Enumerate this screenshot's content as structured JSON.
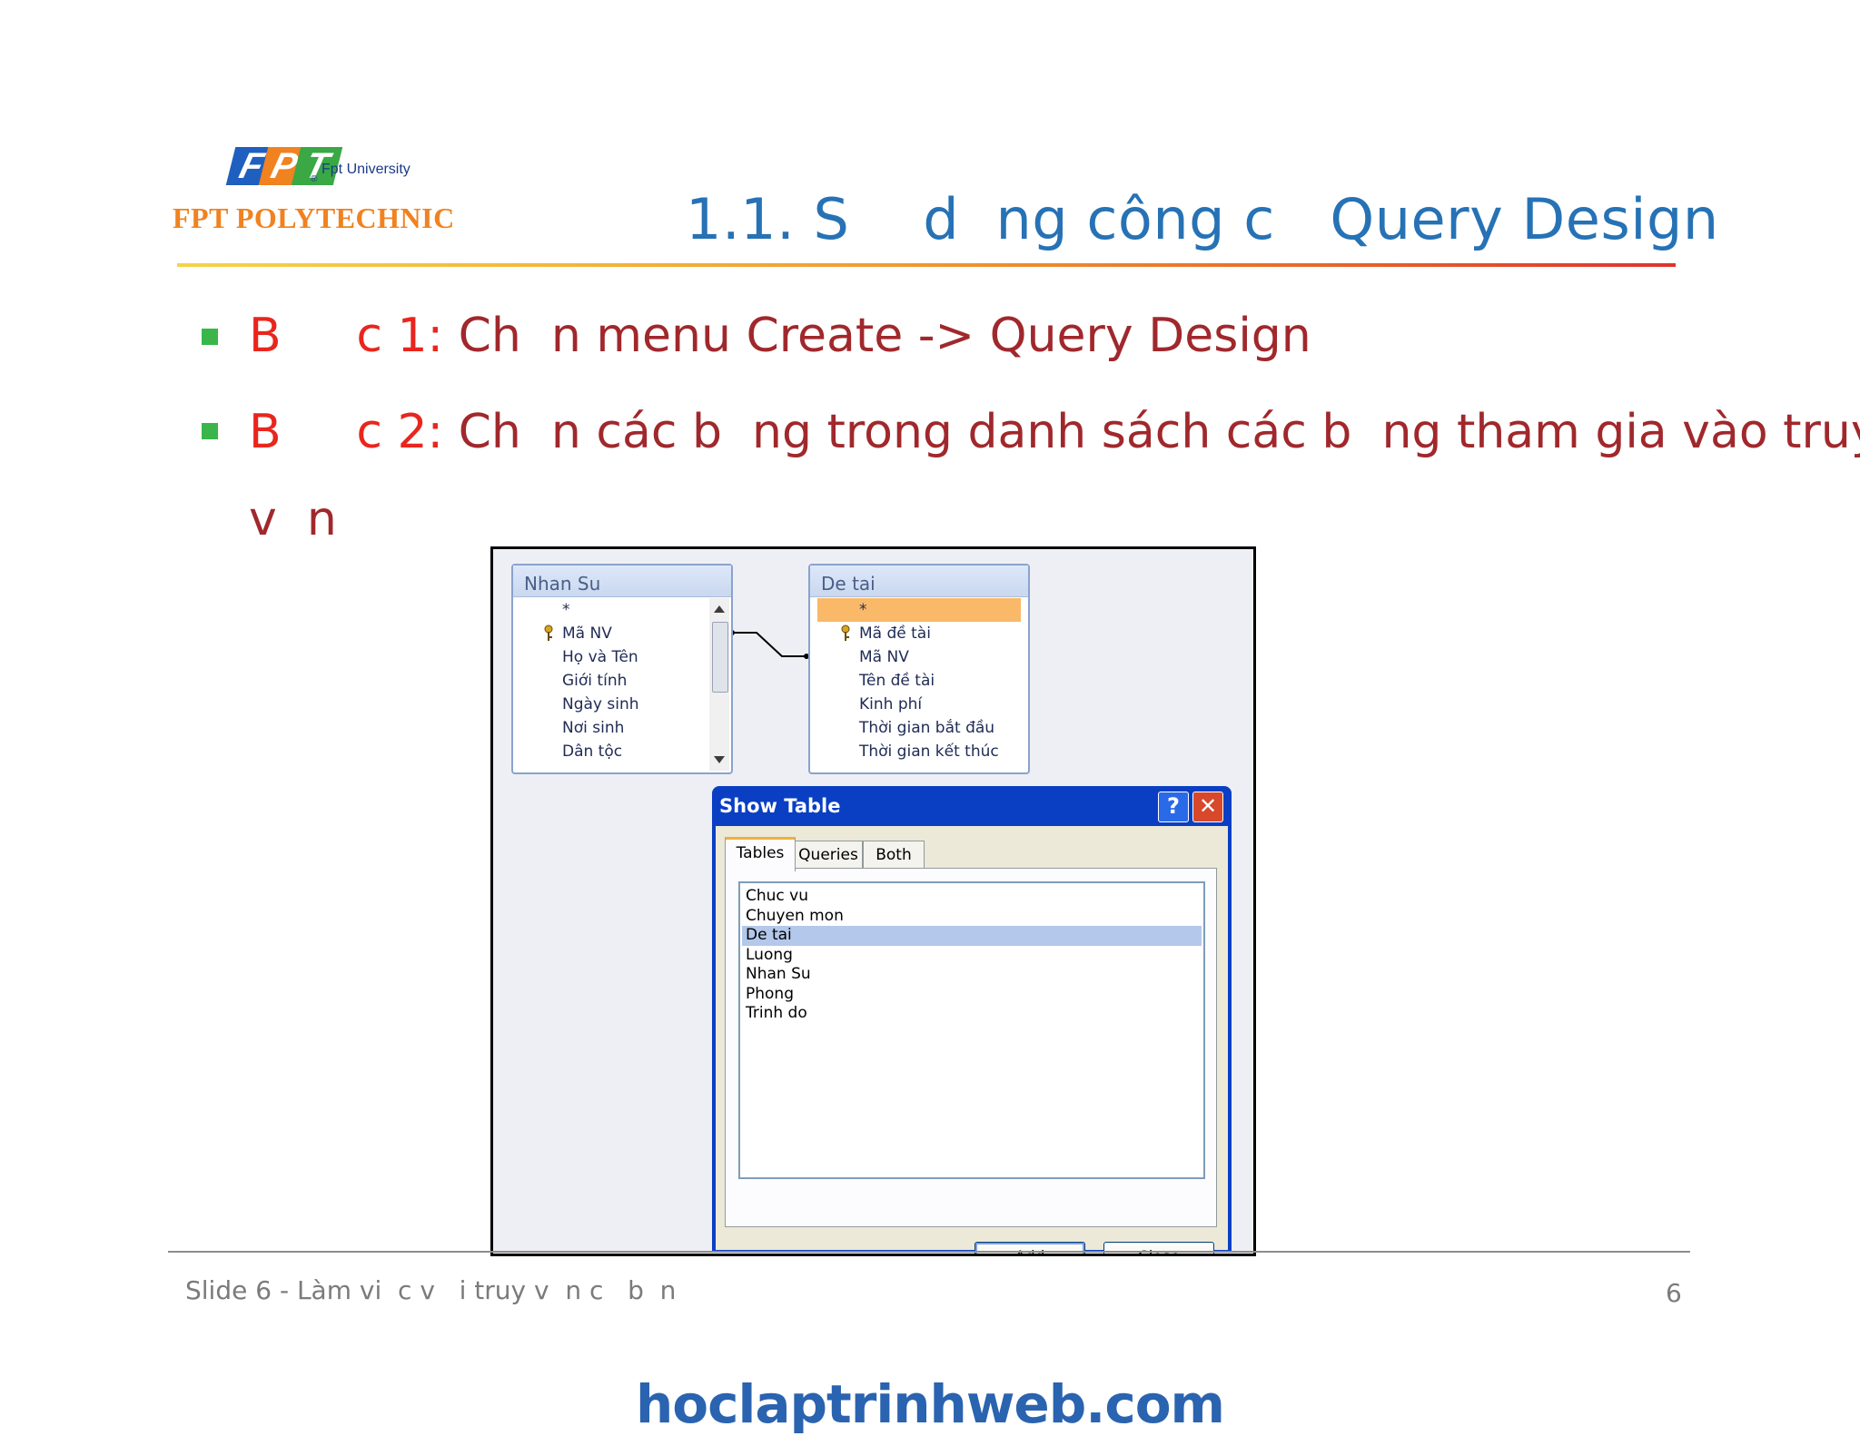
{
  "logo": {
    "letters": [
      "F",
      "P",
      "T"
    ],
    "colors": [
      "#1f5fbf",
      "#f08220",
      "#39a845"
    ],
    "university": "Fpt University",
    "registered": "®",
    "polytechnic": "FPT POLYTECHNIC"
  },
  "slide": {
    "title": "1.1. S    d  ng công c   Query Design",
    "bullets": [
      {
        "prefix": "B     c 1: ",
        "text": "Ch  n menu Create -> Query Design"
      },
      {
        "prefix": "B     c 2: ",
        "text": "Ch  n các b  ng trong danh sách các b  ng tham gia vào truy"
      }
    ],
    "continuation": "v  n"
  },
  "access": {
    "tables": [
      {
        "title": "Nhan Su",
        "fields": [
          "*",
          "Mã NV",
          "Họ và Tên",
          "Giới tính",
          "Ngày sinh",
          "Nơi sinh",
          "Dân tộc"
        ]
      },
      {
        "title": "De tai",
        "fields": [
          "*",
          "Mã đề tài",
          "Mã NV",
          "Tên đề tài",
          "Kinh phí",
          "Thời gian bắt đầu",
          "Thời gian kết thúc"
        ]
      }
    ],
    "dialog": {
      "title": "Show Table",
      "help": "?",
      "close": "✕",
      "tabs": [
        "Tables",
        "Queries",
        "Both"
      ],
      "active_tab": "Tables",
      "items": [
        "Chuc vu",
        "Chuyen mon",
        "De tai",
        "Luong",
        "Nhan Su",
        "Phong",
        "Trinh do"
      ],
      "selected": "De tai",
      "add": "Add",
      "close_button": "Close"
    }
  },
  "footer": {
    "text": "Slide 6 - Làm vi  c v   i truy v  n c   b  n",
    "page": "6"
  },
  "watermark": "hoclaptrinhweb.com"
}
